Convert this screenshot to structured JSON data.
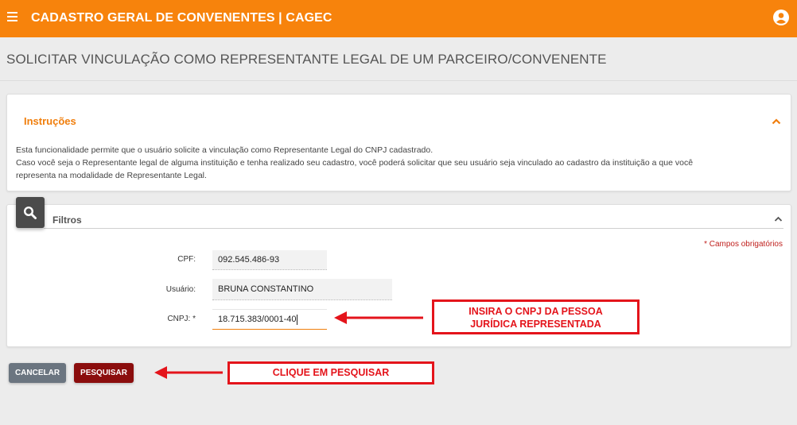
{
  "header": {
    "app_title": "CADASTRO GERAL DE CONVENENTES | CAGEC",
    "menu_icon": "hamburger-icon",
    "user_icon": "user-account-icon",
    "bg_color": "#f7830c"
  },
  "page": {
    "title": "SOLICITAR VINCULAÇÃO COMO REPRESENTANTE LEGAL DE UM PARCEIRO/CONVENENTE"
  },
  "instructions": {
    "title": "Instruções",
    "line1": "Esta funcionalidade permite que o usuário solicite a vinculação como Representante Legal do CNPJ cadastrado.",
    "line2": "Caso você seja o Representante legal de alguma instituição e tenha realizado seu cadastro, você poderá solicitar que seu usuário seja vinculado ao cadastro da instituição a que você",
    "line3": "representa na modalidade de Representante Legal."
  },
  "filters": {
    "title": "Filtros",
    "required_note": "* Campos obrigatórios",
    "cpf_label": "CPF:",
    "cpf_value": "092.545.486-93",
    "user_label": "Usuário:",
    "user_value": "BRUNA CONSTANTINO",
    "cnpj_label": "CNPJ: *",
    "cnpj_value": "18.715.383/0001-40"
  },
  "buttons": {
    "cancel": "CANCELAR",
    "search": "PESQUISAR"
  },
  "annotations": {
    "callout1_line1": "INSIRA O CNPJ DA PESSOA",
    "callout1_line2": "JURÍDICA REPRESENTADA",
    "callout2": "CLIQUE EM PESQUISAR",
    "color": "#e4141b"
  }
}
